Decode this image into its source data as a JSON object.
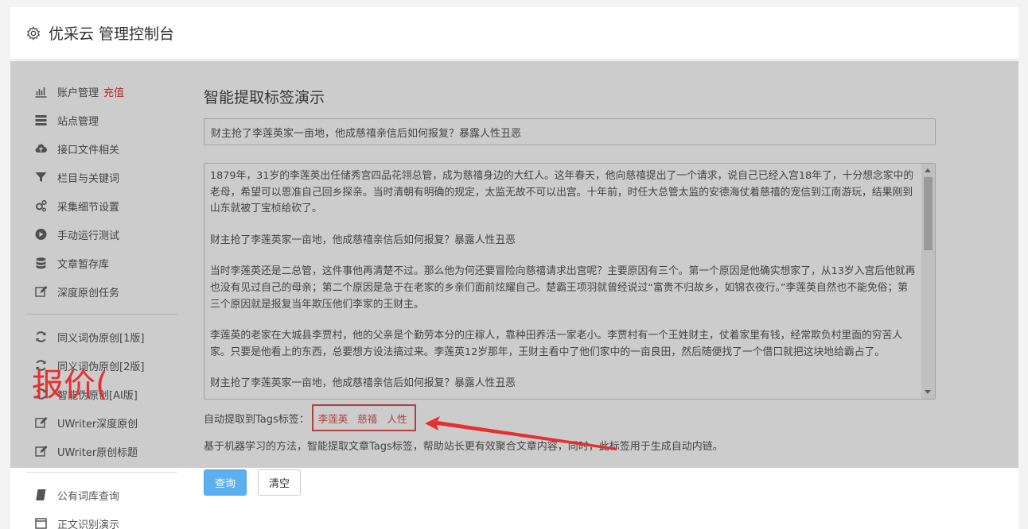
{
  "header": {
    "title": "优采云 管理控制台",
    "icon": "gear-icon"
  },
  "sidebar": {
    "items": [
      {
        "label": "账户管理",
        "badge": "充值",
        "icon": "bar-chart-icon"
      },
      {
        "label": "站点管理",
        "icon": "server-icon"
      },
      {
        "label": "接口文件相关",
        "icon": "cloud-upload-icon"
      },
      {
        "label": "栏目与关键词",
        "icon": "filter-icon"
      },
      {
        "label": "采集细节设置",
        "icon": "cogs-icon"
      },
      {
        "label": "手动运行测试",
        "icon": "play-circle-icon"
      },
      {
        "label": "文章暂存库",
        "icon": "database-icon"
      },
      {
        "label": "深度原创任务",
        "icon": "edit-icon"
      }
    ],
    "items2": [
      {
        "label": "同义词伪原创[1版]",
        "icon": "refresh-icon"
      },
      {
        "label": "同义词伪原创[2版]",
        "icon": "refresh-icon"
      },
      {
        "label": "智能伪原创[AI版]",
        "icon": "refresh-icon"
      },
      {
        "label": "UWriter深度原创",
        "icon": "edit-icon"
      },
      {
        "label": "UWriter原创标题",
        "icon": "edit-icon"
      }
    ],
    "items3": [
      {
        "label": "公有词库查询",
        "icon": "book-icon"
      },
      {
        "label": "正文识别演示",
        "icon": "window-icon"
      }
    ]
  },
  "main": {
    "page_title": "智能提取标签演示",
    "title_input_value": "财主抢了李莲英家一亩地，他成慈禧亲信后如何报复？暴露人性丑恶",
    "content_paragraphs": [
      "1879年，31岁的李莲英出任储秀宫四品花翎总管，成为慈禧身边的大红人。这年春天，他向慈禧提出了一个请求，说自己已经入宫18年了，十分想念家中的老母，希望可以恩准自己回乡探亲。当时清朝有明确的规定，太监无故不可以出宫。十年前，时任大总管太监的安德海仗着慈禧的宠信到江南游玩，结果刚到山东就被丁宝桢给砍了。",
      "财主抢了李莲英家一亩地，他成慈禧亲信后如何报复？暴露人性丑恶",
      "当时李莲英还是二总管，这件事他再清楚不过。那么他为何还要冒险向慈禧请求出宫呢？主要原因有三个。第一个原因是他确实想家了，从13岁入宫后他就再也没有见过自己的母亲；第二个原因是急于在老家的乡亲们面前炫耀自己。楚霸王项羽就曾经说过“富贵不归故乡，如锦衣夜行。”李莲英自然也不能免俗；第三个原因就是报复当年欺压他们李家的王财主。",
      "李莲英的老家在大城县李贾村，他的父亲是个勤劳本分的庄稼人，靠种田养活一家老小。李贾村有一个王姓财主，仗着家里有钱，经常欺负村里面的穷苦人家。只要是他看上的东西，总要想方设法搞过来。李莲英12岁那年，王财主看中了他们家中的一亩良田，然后随便找了一个借口就把这块地给霸占了。",
      "财主抢了李莲英家一亩地，他成慈禧亲信后如何报复？暴露人性丑恶"
    ],
    "tags_label": "自动提取到Tags标签：",
    "tags": [
      "李莲英",
      "慈禧",
      "人性"
    ],
    "description": "基于机器学习的方法，智能提取文章Tags标签，帮助站长更有效聚合文章内容，同时，此标签用于生成自动内链。",
    "query_button": "查询",
    "clear_button": "清空"
  },
  "watermark_text": "报价(",
  "colors": {
    "accent": "#5cb0f0",
    "highlight": "#d9534f",
    "watermark": "#e53030"
  }
}
